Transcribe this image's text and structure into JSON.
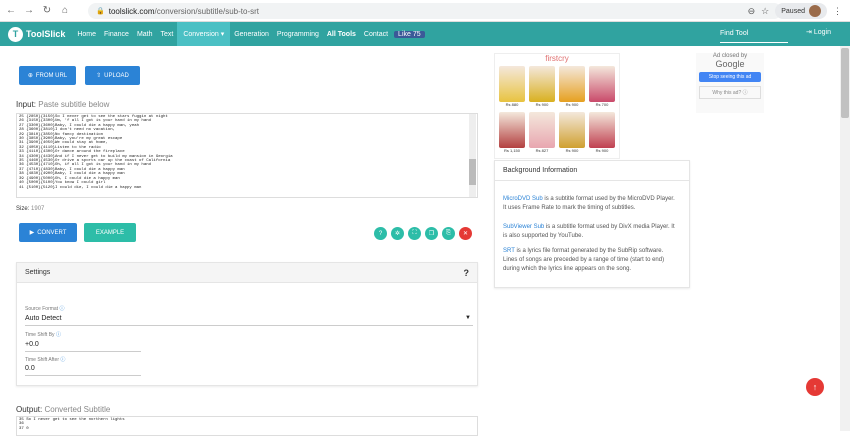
{
  "browser": {
    "url_domain": "toolslick.com",
    "url_path": "/conversion/subtitle/sub-to-srt",
    "profile_status": "Paused"
  },
  "nav": {
    "logo": "ToolSlick",
    "items": [
      "Home",
      "Finance",
      "Math",
      "Text",
      "Conversion ▾",
      "Generation",
      "Programming",
      "All Tools",
      "Contact"
    ],
    "fb_like": "Like 75",
    "find_tool": "Find Tool",
    "login": "Login"
  },
  "toolbar": {
    "from_url": "FROM URL",
    "upload": "UPLOAD"
  },
  "input": {
    "label_prefix": "Input:",
    "label_rest": "Paste subtitle below",
    "lines": [
      "25 {2850}{3150}So I never get to see the stars fuggin at night",
      "26 {3150}{3300}Um, 'f all I got is your hand in my hand",
      "27 {3300}{3600}Baby, I could die a happy man, yeah",
      "28 {3600}{3810}I don't need no vacation,",
      "29 {3810}{3850}No fancy destination",
      "30 {3850}{3900}Baby, you're my great escape",
      "31 {3900}{4050}We could stay at home,",
      "32 {4050}{4110}Listen to the radio",
      "33 {4110}{4300}Or dance around the fireplace",
      "34 {4300}{4430}And if I never get to build my mansion in Georgia",
      "35 {4460}{4530}Or drive a sports car up the coast of California",
      "36 {4530}{4710}Oh, if all I got is your hand in my hand",
      "37 {4710}{4830}Baby, I could die a happy man",
      "38 {4830}{4900}Baby, I could die a happy man",
      "39 {4900}{5000}Oh, I could die a happy man",
      "40 {5000}{5100}You know I could girl",
      "41 {5100}{5120}I could die, I could die a happy man"
    ],
    "size_label": "Size:",
    "size_value": "1907"
  },
  "actions": {
    "convert": "CONVERT",
    "example": "EXAMPLE"
  },
  "settings": {
    "title": "Settings",
    "help": "?",
    "source_format_label": "Source Format",
    "source_format_value": "Auto Detect",
    "time_shift_by_label": "Time Shift By",
    "time_shift_by_value": "+0.0",
    "time_shift_after_label": "Time Shift After",
    "time_shift_after_value": "0.0"
  },
  "output": {
    "label_prefix": "Output:",
    "label_rest": "Converted Subtitle",
    "lines": [
      "35 So I never get to see the northern lights",
      "36",
      "37 0"
    ]
  },
  "background": {
    "title": "Background Information",
    "p1_link": "MicroDVD Sub",
    "p1_text": " is a subtitle format used by the MicroDVD Player. It uses Frame Rate to mark the timing of subtitles.",
    "p2_link": "SubViewer Sub",
    "p2_text": " is a subtitle format used by DivX media Player. It is also supported by YouTube.",
    "p3_link": "SRT",
    "p3_text": " is a lyrics file format generated by the SubRip software. Lines of songs are preceded by a range of time (start to end) during which the lyrics line appears on the song."
  },
  "ads": {
    "brand": "firstcry",
    "prices": [
      "Rs 880",
      "Rs 900",
      "Rs 900",
      "Rs 700",
      "Rs 1,150",
      "Rs 827",
      "Rs 900",
      "Rs 900"
    ],
    "closed_by": "Ad closed by",
    "google": "Google",
    "stop_seeing": "Stop seeing this ad",
    "why": "Why this ad? ⓘ"
  },
  "colors": {
    "nav_teal": "#30a3a0",
    "button_blue": "#2b83d6",
    "button_teal": "#2dbda8",
    "scroll_top_red": "#e53935"
  }
}
